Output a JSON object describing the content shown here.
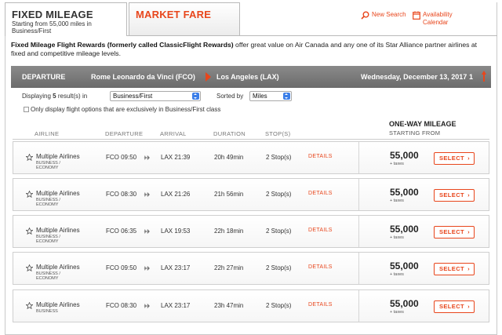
{
  "tabs": {
    "fixed": {
      "title": "FIXED MILEAGE",
      "subtitle_line1": "Starting from  55,000 miles in",
      "subtitle_line2": "Business/First"
    },
    "market": {
      "title": "MARKET FARE"
    }
  },
  "links": {
    "new_search": "New Search",
    "availability_line1": "Availability",
    "availability_line2": "Calendar"
  },
  "intro": {
    "bold": "Fixed Mileage Flight Rewards (formerly called ClassicFlight Rewards)",
    "rest": " offer great value on Air Canada and any one of its Star Alliance partner airlines at fixed and competitive mileage levels."
  },
  "departure": {
    "label": "DEPARTURE",
    "from": "Rome Leonardo da Vinci (FCO)",
    "to": "Los Angeles (LAX)",
    "date": "Wednesday, December 13, 2017",
    "index": "1"
  },
  "filters": {
    "displaying_prefix": "Displaying",
    "count": "5",
    "displaying_suffix": "result(s) in",
    "cabin_selected": "Business/First",
    "sorted_label": "Sorted by",
    "sort_selected": "Miles",
    "checkbox_label": "Only display flight options that are exclusively in Business/First class"
  },
  "columns": {
    "airline": "AIRLINE",
    "departure": "DEPARTURE",
    "arrival": "ARRIVAL",
    "duration": "DURATION",
    "stops": "STOP(S)",
    "mileage_title": "ONE-WAY MILEAGE",
    "mileage_sub": "STARTING FROM"
  },
  "flights": [
    {
      "airline": "Multiple Airlines",
      "cabin1": "BUSINESS /",
      "cabin2": "ECONOMY",
      "dep": "FCO 09:50",
      "arr": "LAX 21:39",
      "duration": "20h 49min",
      "stops": "2 Stop(s)",
      "details": "DETAILS",
      "miles": "55,000",
      "taxes": "+ taxes",
      "select": "SELECT"
    },
    {
      "airline": "Multiple Airlines",
      "cabin1": "BUSINESS /",
      "cabin2": "ECONOMY",
      "dep": "FCO 08:30",
      "arr": "LAX 21:26",
      "duration": "21h 56min",
      "stops": "2 Stop(s)",
      "details": "DETAILS",
      "miles": "55,000",
      "taxes": "+ taxes",
      "select": "SELECT"
    },
    {
      "airline": "Multiple Airlines",
      "cabin1": "BUSINESS /",
      "cabin2": "ECONOMY",
      "dep": "FCO 06:35",
      "arr": "LAX 19:53",
      "duration": "22h 18min",
      "stops": "2 Stop(s)",
      "details": "DETAILS",
      "miles": "55,000",
      "taxes": "+ taxes",
      "select": "SELECT"
    },
    {
      "airline": "Multiple Airlines",
      "cabin1": "BUSINESS /",
      "cabin2": "ECONOMY",
      "dep": "FCO 09:50",
      "arr": "LAX 23:17",
      "duration": "22h 27min",
      "stops": "2 Stop(s)",
      "details": "DETAILS",
      "miles": "55,000",
      "taxes": "+ taxes",
      "select": "SELECT"
    },
    {
      "airline": "Multiple Airlines",
      "cabin1": "BUSINESS",
      "cabin2": "",
      "dep": "FCO 08:30",
      "arr": "LAX 23:17",
      "duration": "23h 47min",
      "stops": "2 Stop(s)",
      "details": "DETAILS",
      "miles": "55,000",
      "taxes": "+ taxes",
      "select": "SELECT"
    }
  ],
  "colors": {
    "accent": "#e8461c",
    "bar": "#777777",
    "dropdown": "#3b7ee8"
  },
  "icons": {
    "search": "search-icon",
    "calendar": "calendar-icon",
    "star": "star-outline-icon",
    "plane": "plane-icon",
    "arrow": "arrow-right-icon",
    "up": "arrow-up-icon"
  }
}
